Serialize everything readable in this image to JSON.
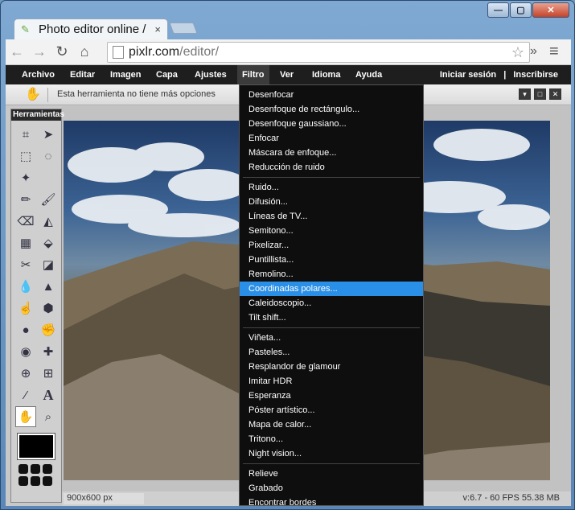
{
  "browser": {
    "tab_title": "Photo editor online /",
    "tab_close": "×",
    "url_host": "pixlr.com",
    "url_path": "/editor/",
    "more": "»"
  },
  "menubar": {
    "items": [
      "Archivo",
      "Editar",
      "Imagen",
      "Capa",
      "Ajustes",
      "Filtro",
      "Ver",
      "Idioma",
      "Ayuda"
    ],
    "login": "Iniciar sesión",
    "divider": "|",
    "signup": "Inscribirse"
  },
  "options_bar": {
    "message": "Esta herramienta no tiene más opciones"
  },
  "tools_panel": {
    "title": "Herramientas"
  },
  "filter_menu": {
    "groups": [
      [
        "Desenfocar",
        "Desenfoque de rectángulo...",
        "Desenfoque gaussiano...",
        "Enfocar",
        "Máscara de enfoque...",
        "Reducción de ruido"
      ],
      [
        "Ruido...",
        "Difusión...",
        "Líneas de TV...",
        "Semitono...",
        "Pixelizar...",
        "Puntillista...",
        "Remolino...",
        "Coordinadas polares...",
        "Caleidoscopio...",
        "Tilt shift..."
      ],
      [
        "Viñeta...",
        "Pasteles...",
        "Resplandor de glamour",
        "Imitar HDR",
        "Esperanza",
        "Póster artístico...",
        "Mapa de calor...",
        "Tritono...",
        "Night vision..."
      ],
      [
        "Relieve",
        "Grabado",
        "Encontrar bordes"
      ]
    ],
    "highlighted": "Coordinadas polares..."
  },
  "status": {
    "image_size": "900x600 px",
    "fps": "v:6.7 - 60 FPS 55.38 MB"
  },
  "colors": {
    "menu_bg": "#1e1e1e",
    "highlight": "#2a8fe6"
  }
}
